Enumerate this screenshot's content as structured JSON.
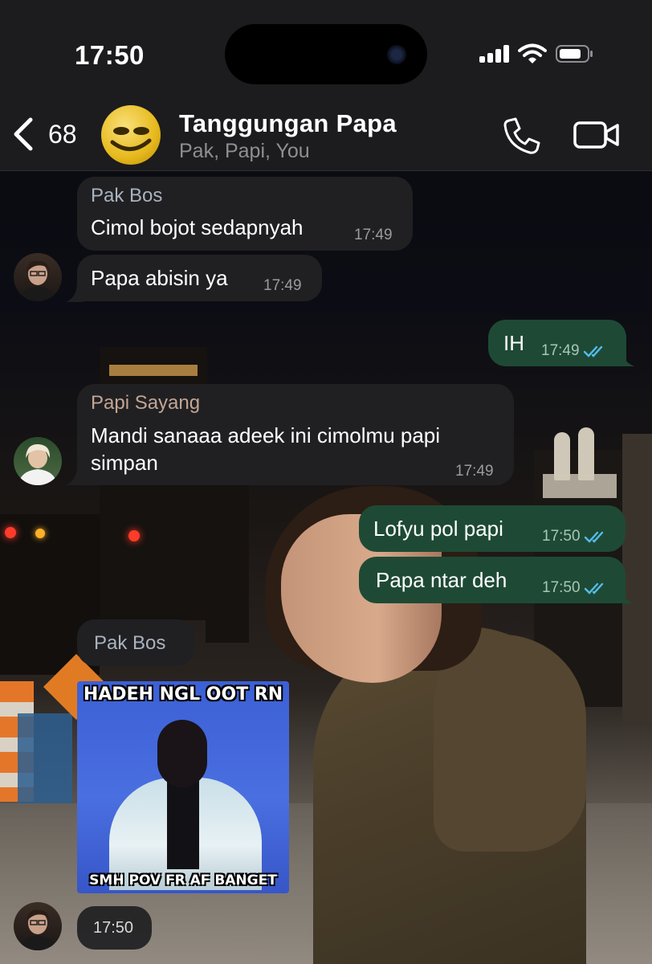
{
  "status_bar": {
    "time": "17:50"
  },
  "header": {
    "back_count": "68",
    "group_name": "Tanggungan Papa",
    "members": "Pak, Papi, You"
  },
  "messages": [
    {
      "from": "Pak Bos",
      "text": "Cimol bojot sedapnyah",
      "time": "17:49"
    },
    {
      "text": "Papa abisin ya",
      "time": "17:49"
    },
    {
      "text": "IH",
      "time": "17:49",
      "outgoing": true
    },
    {
      "from": "Papi Sayang",
      "text_line1": "Mandi sanaaa adeek ini cimolmu papi",
      "text_line2": "simpan",
      "time": "17:49"
    },
    {
      "text": "Lofyu pol papi",
      "time": "17:50",
      "outgoing": true
    },
    {
      "text": "Papa ntar deh",
      "time": "17:50",
      "outgoing": true
    },
    {
      "from": "Pak Bos"
    },
    {
      "meme_top": "HADEH NGL OOT RN",
      "meme_bottom": "SMH POV FR AF BANGET",
      "time": "17:50"
    }
  ],
  "colors": {
    "incoming_bubble": "#202022",
    "outgoing_bubble": "#1e4a35",
    "read_tick": "#53bdeb",
    "pak_bos_name": "#a9b3bf",
    "papi_name": "#c2a594"
  },
  "icons": [
    "back-chevron-icon",
    "phone-icon",
    "video-camera-icon",
    "signal-icon",
    "wifi-icon",
    "battery-icon",
    "double-check-icon"
  ]
}
